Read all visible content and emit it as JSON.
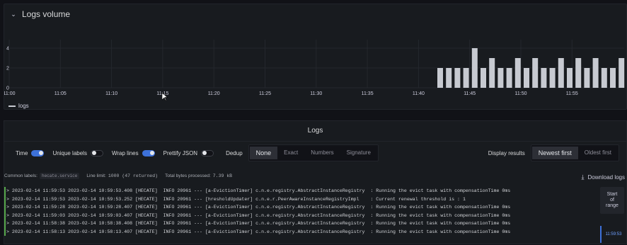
{
  "logs_volume": {
    "title": "Logs volume",
    "legend_label": "logs",
    "chart_data": {
      "type": "bar",
      "title": "Logs volume",
      "xlabel": "",
      "ylabel": "",
      "x_tick_labels": [
        "11:00",
        "11:05",
        "11:10",
        "11:15",
        "11:20",
        "11:25",
        "11:30",
        "11:35",
        "11:40",
        "11:45",
        "11:50",
        "11:55"
      ],
      "y_tick_labels": [
        "0",
        "2",
        "4"
      ],
      "ylim": [
        0,
        4.5
      ],
      "series": [
        {
          "name": "logs",
          "color": "#c7cad1",
          "values": [
            2,
            2,
            2,
            2,
            4,
            2,
            3,
            2,
            2,
            3,
            2,
            3,
            2,
            2,
            3,
            2,
            3,
            2,
            3,
            2,
            2,
            3
          ]
        }
      ],
      "legend_placement": "bottom-left",
      "grid": true
    }
  },
  "logs_panel": {
    "title": "Logs",
    "controls": {
      "time_label": "Time",
      "time_on": true,
      "unique_labels_label": "Unique labels",
      "unique_labels_on": false,
      "wrap_lines_label": "Wrap lines",
      "wrap_lines_on": true,
      "prettify_json_label": "Prettify JSON",
      "prettify_json_on": false,
      "dedup_label": "Dedup",
      "dedup_options": [
        "None",
        "Exact",
        "Numbers",
        "Signature"
      ],
      "dedup_selected": "None",
      "display_results_label": "Display results",
      "display_results_options": [
        "Newest first",
        "Oldest first"
      ],
      "display_results_selected": "Newest first"
    },
    "meta": {
      "common_labels_label": "Common labels:",
      "common_labels_value": "hecate.service",
      "line_limit_label": "Line limit:",
      "line_limit_value": "1000 (47 returned)",
      "bytes_label": "Total bytes processed:",
      "bytes_value": "7.39 kB"
    },
    "download_label": "Download logs",
    "rows": [
      "> 2023-02-14 11:59:53 2023-02-14 10:59:53.408 [HECATE]  INFO 20961 --- [a-EvictionTimer] c.n.e.registry.AbstractInstanceRegistry  : Running the evict task with compensationTime 0ms",
      "> 2023-02-14 11:59:53 2023-02-14 10:59:53.252 [HECATE]  INFO 20961 --- [hresholdUpdater] c.n.e.r.PeerAwareInstanceRegistryImpl    : Current renewal threshold is : 1",
      "> 2023-02-14 11:59:28 2023-02-14 10:59:28.407 [HECATE]  INFO 20961 --- [a-EvictionTimer] c.n.e.registry.AbstractInstanceRegistry  : Running the evict task with compensationTime 0ms",
      "> 2023-02-14 11:59:03 2023-02-14 10:59:03.407 [HECATE]  INFO 20961 --- [a-EvictionTimer] c.n.e.registry.AbstractInstanceRegistry  : Running the evict task with compensationTime 0ms",
      "> 2023-02-14 11:58:38 2023-02-14 10:58:38.408 [HECATE]  INFO 20961 --- [a-EvictionTimer] c.n.e.registry.AbstractInstanceRegistry  : Running the evict task with compensationTime 0ms",
      "> 2023-02-14 11:58:13 2023-02-14 10:58:13.407 [HECATE]  INFO 20961 --- [a-EvictionTimer] c.n.e.registry.AbstractInstanceRegistry  : Running the evict task with compensationTime 0ms"
    ],
    "side": {
      "start_of_range_lines": [
        "Start",
        "of",
        "range"
      ],
      "time_marker": "11:59:53"
    }
  }
}
